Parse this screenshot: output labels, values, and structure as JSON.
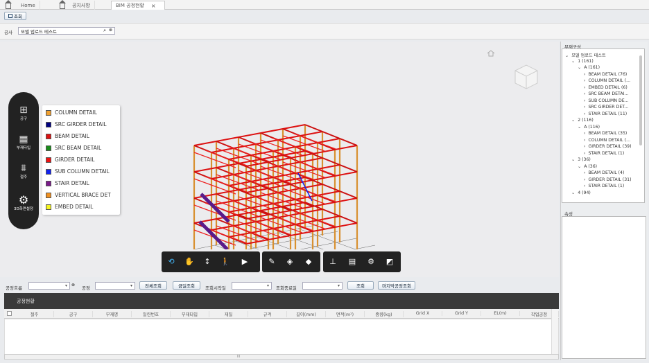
{
  "tabs": [
    {
      "label": "Home"
    },
    {
      "label": "공지사항"
    },
    {
      "label": "BIM 공정현황"
    }
  ],
  "toolbar": {
    "query_label": "조회"
  },
  "project": {
    "label": "공사",
    "value": "모델 업로드 테스트"
  },
  "left_tools": [
    {
      "label": "공구",
      "icon": "grid-small-icon"
    },
    {
      "label": "부재타입",
      "icon": "grid-icon"
    },
    {
      "label": "절주",
      "icon": "structure-icon"
    },
    {
      "label": "3D화면설정",
      "icon": "gear-icon"
    }
  ],
  "legend": [
    {
      "label": "COLUMN DETAIL",
      "color": "#f0a030"
    },
    {
      "label": "SRC GIRDER DETAIL",
      "color": "#000080"
    },
    {
      "label": "BEAM DETAIL",
      "color": "#dd1111"
    },
    {
      "label": "SRC BEAM DETAIL",
      "color": "#1a8a1a"
    },
    {
      "label": "GIRDER DETAIL",
      "color": "#ee1111"
    },
    {
      "label": "SUB COLUMN DETAIL",
      "color": "#1122ee"
    },
    {
      "label": "STAIR DETAIL",
      "color": "#7a1a8a"
    },
    {
      "label": "VERTICAL BRACE DET",
      "color": "#f09020"
    },
    {
      "label": "EMBED DETAIL",
      "color": "#f5f520"
    }
  ],
  "right_panel": {
    "title": "부재구성",
    "props_title": "속성"
  },
  "tree": [
    {
      "label": "모델 업로드 테스트",
      "level": 0,
      "arrow": "⌄"
    },
    {
      "label": "1 (161)",
      "level": 1,
      "arrow": "⌄"
    },
    {
      "label": "A (161)",
      "level": 2,
      "arrow": "⌄"
    },
    {
      "label": "BEAM DETAIL (76)",
      "level": 3,
      "arrow": "›"
    },
    {
      "label": "COLUMN DETAIL (...",
      "level": 3,
      "arrow": "›"
    },
    {
      "label": "EMBED DETAIL (6)",
      "level": 3,
      "arrow": "›"
    },
    {
      "label": "SRC BEAM DETAI...",
      "level": 3,
      "arrow": "›"
    },
    {
      "label": "SUB COLUMN DE...",
      "level": 3,
      "arrow": "›"
    },
    {
      "label": "SRC GIRDER DET...",
      "level": 3,
      "arrow": "›"
    },
    {
      "label": "STAIR DETAIL (11)",
      "level": 3,
      "arrow": "›"
    },
    {
      "label": "2 (116)",
      "level": 1,
      "arrow": "⌄"
    },
    {
      "label": "A (116)",
      "level": 2,
      "arrow": "⌄"
    },
    {
      "label": "BEAM DETAIL (35)",
      "level": 3,
      "arrow": "›"
    },
    {
      "label": "COLUMN DETAIL (...",
      "level": 3,
      "arrow": "›"
    },
    {
      "label": "GIRDER DETAIL (39)",
      "level": 3,
      "arrow": "›"
    },
    {
      "label": "STAIR DETAIL (1)",
      "level": 3,
      "arrow": "›"
    },
    {
      "label": "3 (36)",
      "level": 1,
      "arrow": "⌄"
    },
    {
      "label": "A (36)",
      "level": 2,
      "arrow": "⌄"
    },
    {
      "label": "BEAM DETAIL (4)",
      "level": 3,
      "arrow": "›"
    },
    {
      "label": "GIRDER DETAIL (31)",
      "level": 3,
      "arrow": "›"
    },
    {
      "label": "STAIR DETAIL (1)",
      "level": 3,
      "arrow": "›"
    },
    {
      "label": "4 (94)",
      "level": 1,
      "arrow": "⌄"
    }
  ],
  "filters": {
    "process_flow": "공정흐름",
    "process": "공정",
    "all_query": "전체조회",
    "daily_query": "금일조회",
    "start_date": "조회시작일",
    "end_date": "조회종료일",
    "query": "조회",
    "last_process_query": "마지막공정조회"
  },
  "grid": {
    "title": "공정현황",
    "columns": [
      "절주",
      "공구",
      "부재명",
      "일련번호",
      "부재타입",
      "재질",
      "규격",
      "길이(mm)",
      "면적(m²)",
      "중량(kg)",
      "Grid X",
      "Grid Y",
      "EL(m)",
      "작업공정"
    ],
    "scroll_label": "III"
  }
}
